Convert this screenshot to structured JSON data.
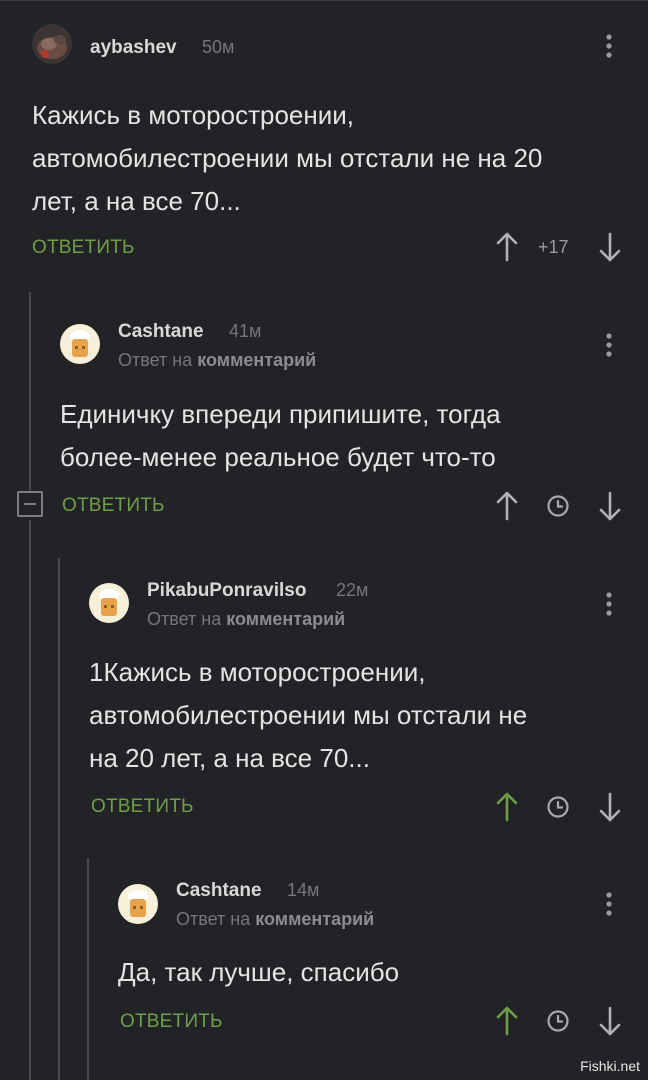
{
  "comments": [
    {
      "username": "aybashev",
      "time": "50м",
      "text_lines": [
        "Кажись в моторостроении,",
        "автомобилестроении мы отстали не на 20",
        "лет, а на все 70..."
      ],
      "reply_label": "ОТВЕТИТЬ",
      "rating": "+17"
    },
    {
      "username": "Cashtane",
      "time": "41м",
      "reply_prefix": "Ответ на",
      "reply_target": "комментарий",
      "text_lines": [
        "Единичку впереди припишите, тогда",
        "более-менее реальное будет что-то"
      ],
      "reply_label": "ОТВЕТИТЬ"
    },
    {
      "username": "PikabuPonravilso",
      "time": "22м",
      "reply_prefix": "Ответ на",
      "reply_target": "комментарий",
      "text_lines": [
        "1Кажись в моторостроении,",
        "автомобилестроении мы отстали не",
        "на 20 лет, а на все 70..."
      ],
      "reply_label": "ОТВЕТИТЬ"
    },
    {
      "username": "Cashtane",
      "time": "14м",
      "reply_prefix": "Ответ на",
      "reply_target": "комментарий",
      "text_lines": [
        "Да, так лучше, спасибо"
      ],
      "reply_label": "ОТВЕТИТЬ"
    }
  ],
  "icons": {
    "menu": "more-vertical-icon",
    "upvote": "arrow-up-icon",
    "downvote": "arrow-down-icon",
    "clock": "clock-icon",
    "collapse": "minus-square-icon"
  },
  "colors": {
    "background": "#222326",
    "accent_green": "#6e9f46",
    "muted": "#75767a"
  },
  "watermark": "Fishki.net"
}
